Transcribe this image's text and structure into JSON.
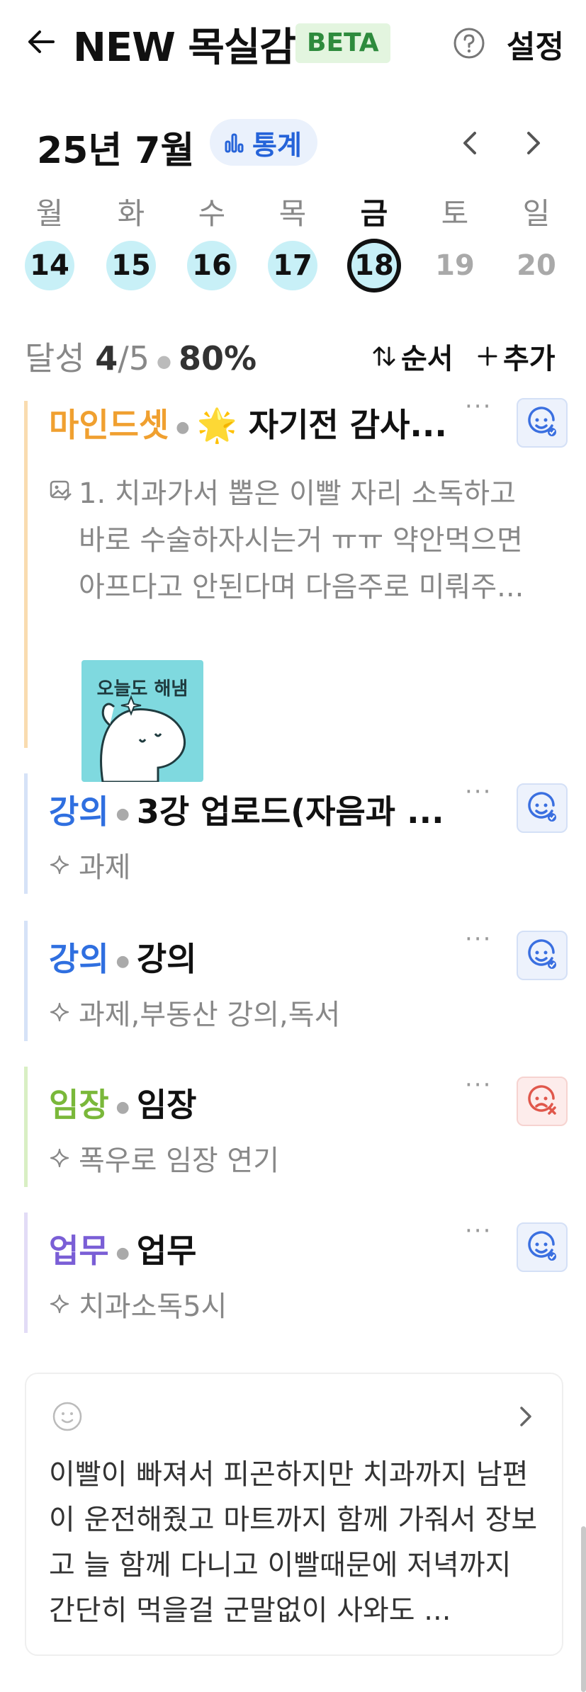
{
  "header": {
    "title": "NEW 목실감",
    "badge": "BETA",
    "settings_label": "설정"
  },
  "calendar": {
    "month_label": "25년 7월",
    "stats_label": "통계",
    "days": [
      {
        "name": "월",
        "num": "14",
        "state": "done"
      },
      {
        "name": "화",
        "num": "15",
        "state": "done"
      },
      {
        "name": "수",
        "num": "16",
        "state": "done"
      },
      {
        "name": "목",
        "num": "17",
        "state": "done"
      },
      {
        "name": "금",
        "num": "18",
        "state": "today"
      },
      {
        "name": "토",
        "num": "19",
        "state": "future"
      },
      {
        "name": "일",
        "num": "20",
        "state": "future"
      }
    ]
  },
  "achievement": {
    "label": "달성",
    "done": "4",
    "total": "/5",
    "percent": "80%",
    "order_label": "순서",
    "add_label": "추가"
  },
  "habits": [
    {
      "category": "마인드셋",
      "name": "🌟 자기전 감사...",
      "color": "#f0a030",
      "bar_color": "#f9dcb0",
      "memo": "1. 치과가서 뽑은 이빨 자리 소독하고 바로 수술하자시는거 ㅠㅠ 약안먹으면 아프다고 안된다며 다음주로 미뤄주...",
      "image_text": "오늘도 해냄",
      "mood": "success"
    },
    {
      "category": "강의",
      "name": "3강 업로드(자음과 ...",
      "color": "#2f6fe0",
      "bar_color": "#d6e2f7",
      "sub": "과제",
      "mood": "success"
    },
    {
      "category": "강의",
      "name": "강의",
      "color": "#2f6fe0",
      "bar_color": "#d6e2f7",
      "sub": "과제,부동산 강의,독서",
      "mood": "success"
    },
    {
      "category": "임장",
      "name": "임장",
      "color": "#7ab83a",
      "bar_color": "#d9efc4",
      "sub": "폭우로 임장 연기",
      "mood": "fail"
    },
    {
      "category": "업무",
      "name": "업무",
      "color": "#7a5ed6",
      "bar_color": "#e2dcf6",
      "sub": "치과소독5시",
      "mood": "success"
    }
  ],
  "diary": {
    "text": "이빨이 빠져서 피곤하지만 치과까지 남편이 운전해줬고 마트까지 함께 가줘서 장보고 늘 함께 다니고 이빨때문에 저녁까지 간단히 먹을걸 군말없이 사와도 ..."
  }
}
